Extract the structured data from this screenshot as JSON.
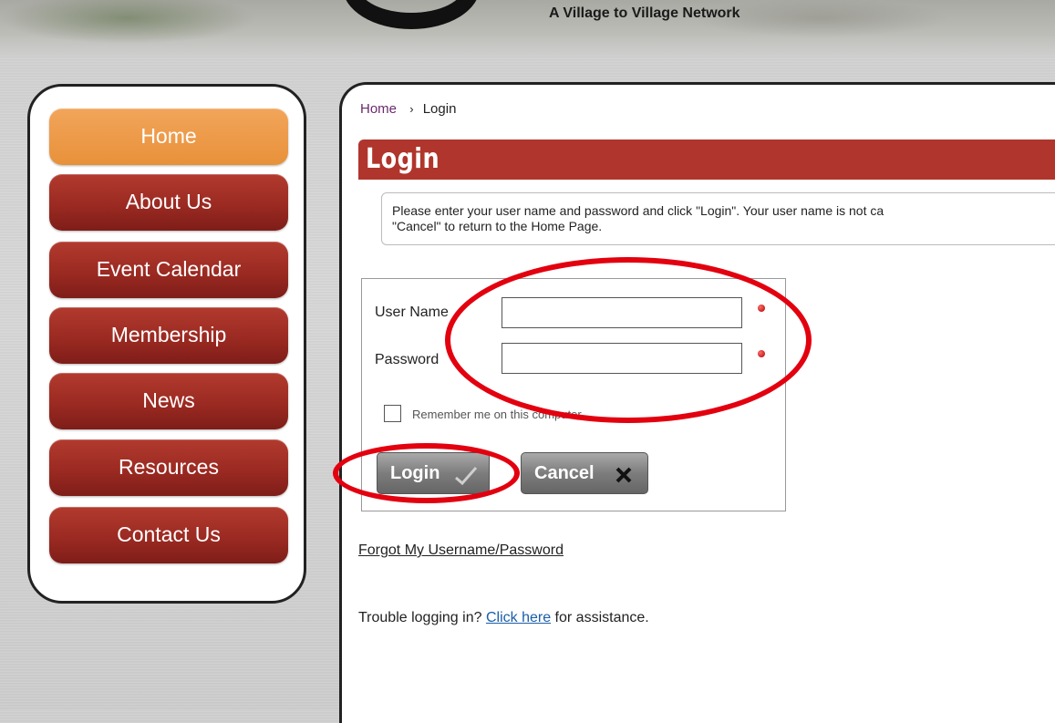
{
  "header": {
    "tagline": "A Village to Village Network"
  },
  "sidebar": {
    "items": [
      {
        "label": "Home"
      },
      {
        "label": "About Us"
      },
      {
        "label": "Event Calendar"
      },
      {
        "label": "Membership"
      },
      {
        "label": "News"
      },
      {
        "label": "Resources"
      },
      {
        "label": "Contact Us"
      }
    ]
  },
  "breadcrumb": {
    "home": "Home",
    "separator": "›",
    "current": "Login"
  },
  "page": {
    "title": "Login",
    "instructions": "Please enter your user name and password and click \"Login\". Your user name is not ca\n\"Cancel\" to return to the Home Page."
  },
  "form": {
    "username_label": "User Name",
    "username_value": "",
    "password_label": "Password",
    "password_value": "",
    "remember_label": "Remember me on this computer",
    "remember_checked": false,
    "login_label": "Login",
    "cancel_label": "Cancel"
  },
  "links": {
    "forgot": "Forgot My Username/Password",
    "trouble_prefix": "Trouble logging in?",
    "trouble_link": "Click here",
    "trouble_suffix": "for assistance."
  },
  "icons": {
    "login": "checkmark-icon",
    "cancel": "x-icon",
    "required": "required-dot-icon"
  },
  "colors": {
    "brand_red": "#b0352c",
    "nav_active": "#e8913a",
    "annotation_red": "#e3000f",
    "link_blue": "#1a5ea8"
  }
}
